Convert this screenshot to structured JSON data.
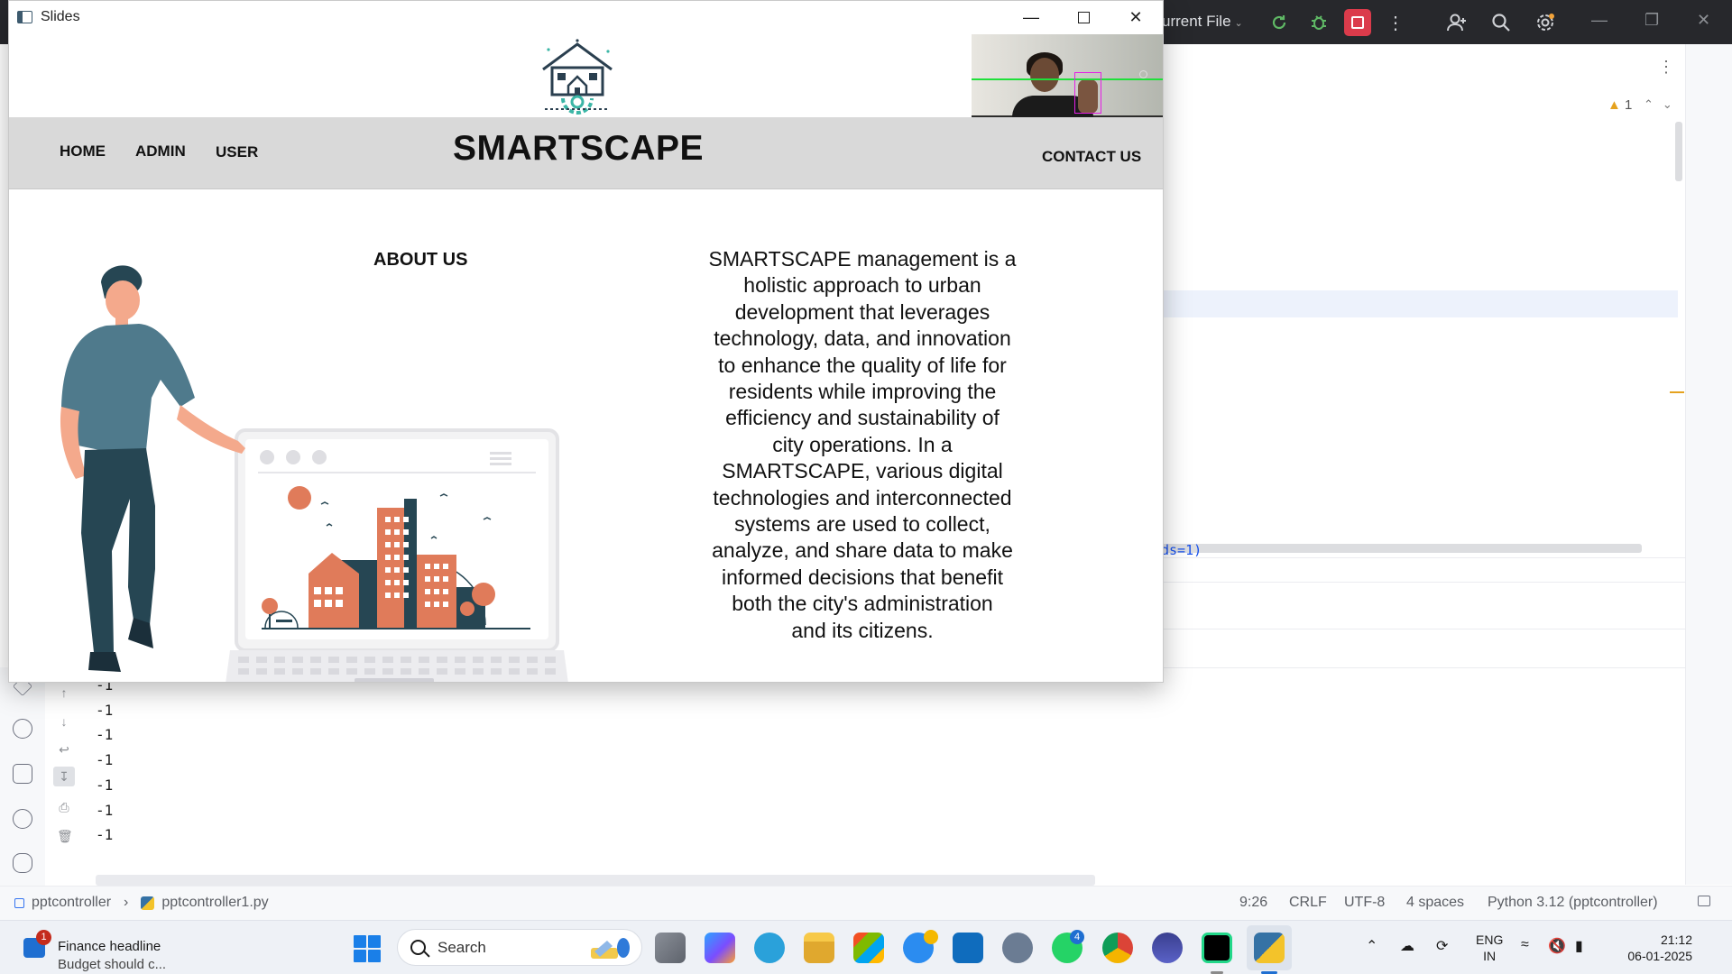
{
  "ide": {
    "run_config_label": "urrent File",
    "warning_count": "1",
    "editor_fragment": "ds=1)",
    "console_lines": [
      "-1",
      "-1",
      "-1",
      "-1",
      "-1",
      "-1",
      "-1"
    ],
    "status": {
      "project": "pptcontroller",
      "file": "pptcontroller1.py",
      "position": "9:26",
      "line_ending": "CRLF",
      "encoding": "UTF-8",
      "indent": "4 spaces",
      "interpreter": "Python 3.12 (pptcontroller)"
    },
    "colors": {
      "stop_button": "#db3b4b",
      "warning": "#e5a21f"
    }
  },
  "slides_window": {
    "title": "Slides",
    "nav": {
      "home": "HOME",
      "admin": "ADMIN",
      "user": "USER",
      "brand": "SMARTSCAPE",
      "contact": "CONTACT US"
    },
    "about_heading": "ABOUT US",
    "about_lines": [
      "SMARTSCAPE management is a",
      "holistic approach to urban",
      "development that leverages",
      "technology, data, and innovation",
      "to enhance the quality of life for",
      "residents while improving the",
      "efficiency and sustainability of",
      "city operations. In a",
      "SMARTSCAPE, various digital",
      "technologies and interconnected",
      "systems are used to collect,",
      "analyze, and share data to make",
      "informed decisions that benefit",
      "both the city's administration",
      "and its citizens."
    ],
    "colors": {
      "nav_background": "#d9d9d9",
      "illustration_accent": "#e07b5a",
      "illustration_dark": "#264653"
    }
  },
  "taskbar": {
    "news": {
      "badge": "1",
      "title": "Finance headline",
      "subtitle": "Budget should c..."
    },
    "search_label": "Search",
    "whatsapp_badge": "4",
    "tray": {
      "lang_line1": "ENG",
      "lang_line2": "IN",
      "time": "21:12",
      "date": "06-01-2025"
    }
  }
}
